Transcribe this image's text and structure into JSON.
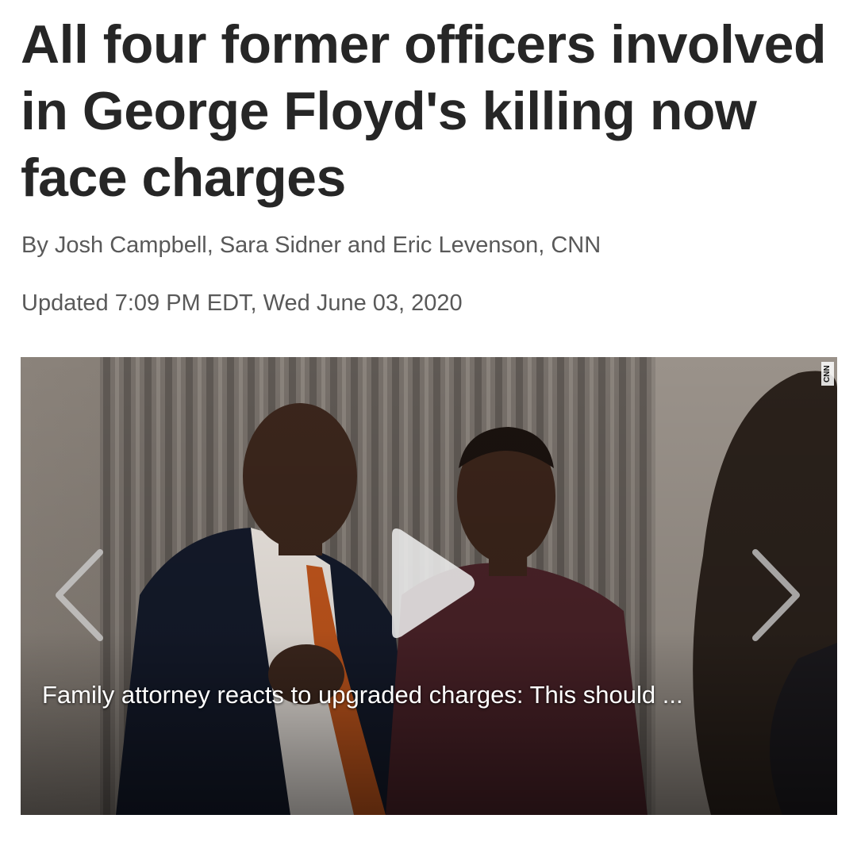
{
  "article": {
    "headline": "All four former officers involved in George Floyd's killing now face charges",
    "byline": "By Josh Campbell, Sara Sidner and Eric Levenson, CNN",
    "updated": "Updated 7:09 PM EDT, Wed June 03, 2020"
  },
  "video": {
    "caption": "Family attorney reacts to upgraded charges: This should ...",
    "watermark": "CNN",
    "play_icon": "play-icon",
    "prev_icon": "chevron-left-icon",
    "next_icon": "chevron-right-icon"
  },
  "colors": {
    "headline": "#262626",
    "meta": "#595959",
    "caption": "#ffffff"
  }
}
